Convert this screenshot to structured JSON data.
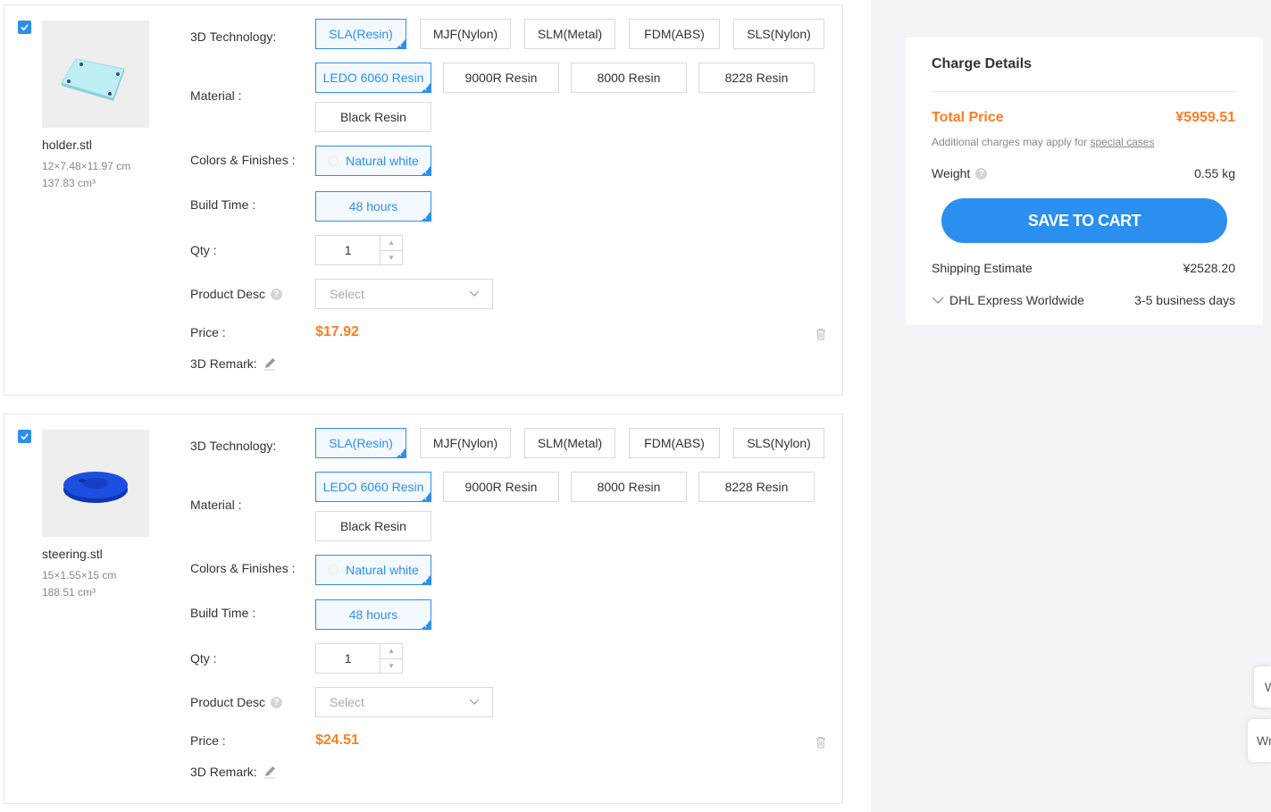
{
  "labels": {
    "technology": "3D Technology:",
    "material": "Material :",
    "colors": "Colors & Finishes :",
    "build_time": "Build Time :",
    "qty": "Qty :",
    "product_desc": "Product Desc",
    "price": "Price :",
    "remark": "3D Remark:"
  },
  "technologies": [
    "SLA(Resin)",
    "MJF(Nylon)",
    "SLM(Metal)",
    "FDM(ABS)",
    "SLS(Nylon)"
  ],
  "materials": [
    "LEDO 6060 Resin",
    "9000R Resin",
    "8000 Resin",
    "8228 Resin",
    "Black Resin"
  ],
  "select_placeholder": "Select",
  "items": [
    {
      "checked": true,
      "file_name": "holder.stl",
      "dimensions": "12×7.48×11.97 cm",
      "volume": "137.83 cm³",
      "selected_technology": "SLA(Resin)",
      "selected_material": "LEDO 6060 Resin",
      "color": "Natural white",
      "build_time": "48 hours",
      "qty": "1",
      "price": "$17.92",
      "thumb_color": "#bdeff4"
    },
    {
      "checked": true,
      "file_name": "steering.stl",
      "dimensions": "15×1.55×15 cm",
      "volume": "188.51 cm³",
      "selected_technology": "SLA(Resin)",
      "selected_material": "LEDO 6060 Resin",
      "color": "Natural white",
      "build_time": "48 hours",
      "qty": "1",
      "price": "$24.51",
      "thumb_color": "#1c4fe0"
    }
  ],
  "charge": {
    "title": "Charge Details",
    "total_label": "Total Price",
    "total_value": "¥5959.51",
    "additional_text": "Additional charges may apply for",
    "special_cases": "special cases",
    "weight_label": "Weight",
    "weight_value": "0.55 kg",
    "save_button": "SAVE TO CART",
    "shipping_label": "Shipping Estimate",
    "shipping_value": "¥2528.20",
    "carrier": "DHL Express Worldwide",
    "delivery": "3-5 business days"
  },
  "side_tabs": [
    "W",
    "Wr"
  ],
  "colors": {
    "accent": "#2b8ff0",
    "price": "#ff7d21",
    "sidebar_bg": "#f3f4f7"
  }
}
